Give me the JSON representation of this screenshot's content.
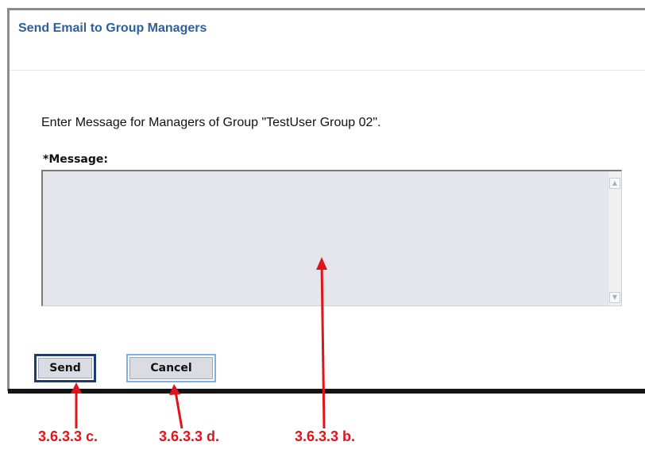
{
  "dialog": {
    "title": "Send Email to Group Managers",
    "instruction": "Enter Message for Managers of Group \"TestUser Group 02\".",
    "message_label": "*Message:",
    "message_value": ""
  },
  "buttons": {
    "send_label": "Send",
    "cancel_label": "Cancel"
  },
  "callouts": {
    "send": "3.6.3.3 c.",
    "cancel": "3.6.3.3 d.",
    "message": "3.6.3.3 b."
  },
  "icons": {
    "scroll_up": "scroll-up-arrow-icon",
    "scroll_down": "scroll-down-arrow-icon"
  },
  "colors": {
    "title": "#2e5f9a",
    "callout": "#e0151b",
    "send_border": "#1c3c6e",
    "cancel_border": "#7fb0e6",
    "textarea_bg": "#e4e6ec"
  }
}
